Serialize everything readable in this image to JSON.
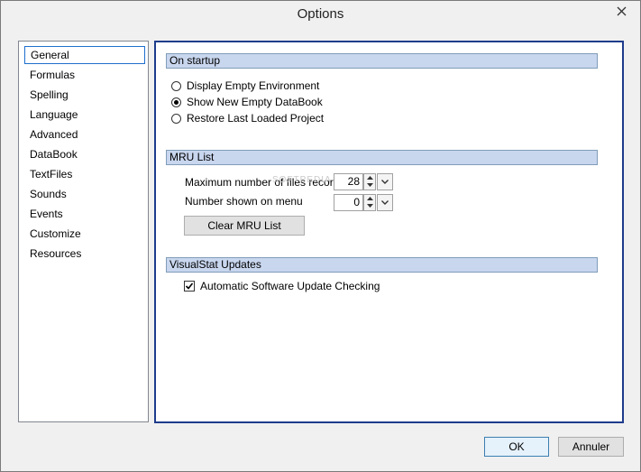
{
  "window": {
    "title": "Options",
    "close_glyph": "✕"
  },
  "nav": {
    "items": [
      {
        "label": "General",
        "selected": true
      },
      {
        "label": "Formulas"
      },
      {
        "label": "Spelling"
      },
      {
        "label": "Language"
      },
      {
        "label": "Advanced"
      },
      {
        "label": "DataBook"
      },
      {
        "label": "TextFiles"
      },
      {
        "label": "Sounds"
      },
      {
        "label": "Events"
      },
      {
        "label": "Customize"
      },
      {
        "label": "Resources"
      }
    ]
  },
  "startup": {
    "header": "On startup",
    "options": [
      {
        "label": "Display Empty Environment",
        "selected": false
      },
      {
        "label": "Show New Empty DataBook",
        "selected": true
      },
      {
        "label": "Restore Last Loaded Project",
        "selected": false
      }
    ]
  },
  "mru": {
    "header": "MRU List",
    "max_files_label": "Maximum number of files recorded",
    "max_files_value": "28",
    "shown_label": "Number shown on menu",
    "shown_value": "0",
    "clear_button": "Clear MRU List",
    "watermark": "SOFTPEDIA"
  },
  "updates": {
    "header": "VisualStat Updates",
    "auto_check_label": "Automatic Software Update Checking",
    "auto_check_checked": true
  },
  "footer": {
    "ok_label": "OK",
    "cancel_label": "Annuler"
  },
  "colors": {
    "panel_border": "#1e3c8c",
    "section_header_bg": "#c8d6ee",
    "selection_border": "#1e6fce"
  }
}
